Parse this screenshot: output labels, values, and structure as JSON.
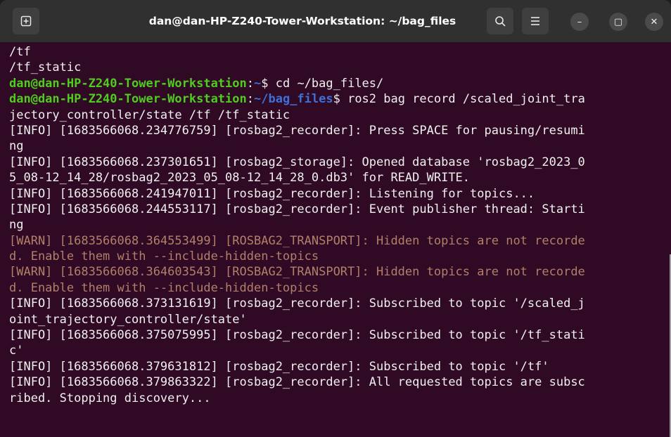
{
  "window": {
    "title": "dan@dan-HP-Z240-Tower-Workstation: ~/bag_files",
    "buttons": {
      "new_tab_icon": "new-tab-icon",
      "search_icon": "search-icon",
      "menu_icon": "hamburger-menu-icon",
      "minimize_glyph": "–",
      "maximize_glyph": "▢",
      "close_glyph": "✕"
    }
  },
  "terminal": {
    "lines": [
      {
        "type": "plain",
        "text": "/tf"
      },
      {
        "type": "plain",
        "text": "/tf_static"
      },
      {
        "type": "prompt",
        "user": "dan@dan-HP-Z240-Tower-Workstation",
        "sep": ":",
        "path": "~",
        "rest": "$ cd ~/bag_files/"
      },
      {
        "type": "prompt",
        "user": "dan@dan-HP-Z240-Tower-Workstation",
        "sep": ":",
        "path": "~/bag_files",
        "rest": "$ ros2 bag record /scaled_joint_tra"
      },
      {
        "type": "plain",
        "text": "jectory_controller/state /tf /tf_static"
      },
      {
        "type": "plain",
        "text": "[INFO] [1683566068.234776759] [rosbag2_recorder]: Press SPACE for pausing/resumi"
      },
      {
        "type": "plain",
        "text": "ng"
      },
      {
        "type": "plain",
        "text": "[INFO] [1683566068.237301651] [rosbag2_storage]: Opened database 'rosbag2_2023_0"
      },
      {
        "type": "plain",
        "text": "5_08-12_14_28/rosbag2_2023_05_08-12_14_28_0.db3' for READ_WRITE."
      },
      {
        "type": "plain",
        "text": "[INFO] [1683566068.241947011] [rosbag2_recorder]: Listening for topics..."
      },
      {
        "type": "plain",
        "text": "[INFO] [1683566068.244553117] [rosbag2_recorder]: Event publisher thread: Starti"
      },
      {
        "type": "plain",
        "text": "ng"
      },
      {
        "type": "warn",
        "text": "[WARN] [1683566068.364553499] [ROSBAG2_TRANSPORT]: Hidden topics are not recorde"
      },
      {
        "type": "warn",
        "text": "d. Enable them with --include-hidden-topics"
      },
      {
        "type": "warn",
        "text": "[WARN] [1683566068.364603543] [ROSBAG2_TRANSPORT]: Hidden topics are not recorde"
      },
      {
        "type": "warn",
        "text": "d. Enable them with --include-hidden-topics"
      },
      {
        "type": "plain",
        "text": "[INFO] [1683566068.373131619] [rosbag2_recorder]: Subscribed to topic '/scaled_j"
      },
      {
        "type": "plain",
        "text": "oint_trajectory_controller/state'"
      },
      {
        "type": "plain",
        "text": "[INFO] [1683566068.375075995] [rosbag2_recorder]: Subscribed to topic '/tf_stati"
      },
      {
        "type": "plain",
        "text": "c'"
      },
      {
        "type": "plain",
        "text": "[INFO] [1683566068.379631812] [rosbag2_recorder]: Subscribed to topic '/tf'"
      },
      {
        "type": "plain",
        "text": "[INFO] [1683566068.379863322] [rosbag2_recorder]: All requested topics are subsc"
      },
      {
        "type": "plain",
        "text": "ribed. Stopping discovery..."
      }
    ]
  },
  "colors": {
    "background": "#300a24",
    "titlebar": "#303030",
    "prompt_user": "#4fcc1f",
    "prompt_path": "#3f6fd8",
    "warn_text": "#b1806a",
    "text": "#f0f0f0"
  }
}
